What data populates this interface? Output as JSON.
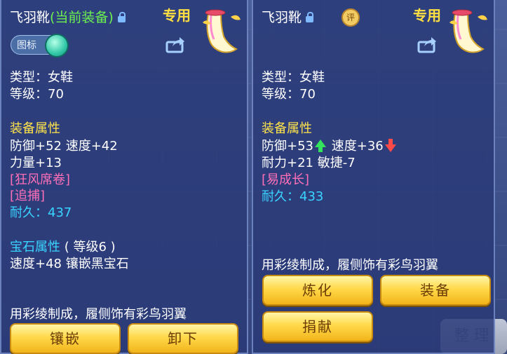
{
  "left": {
    "item_name": "飞羽靴",
    "current_tag": "(当前装备)",
    "exclusive": "专用",
    "icon_toggle": "图标",
    "type_line": "类型：女鞋",
    "level_line": "等级：70",
    "attr_header": "装备属性",
    "stat1": "防御+52 速度+42",
    "stat2": "力量+13",
    "skill1": "[狂风席卷]",
    "skill2": "[追捕]",
    "durability": "耐久：437",
    "gem_header": "宝石属性",
    "gem_level": "( 等级6 )",
    "gem_detail": "速度+48 镶嵌黑宝石",
    "description": "用彩绫制成，履侧饰有彩鸟羽翼",
    "buttons": {
      "inlay": "镶嵌",
      "unequip": "卸下"
    }
  },
  "right": {
    "item_name": "飞羽靴",
    "eval_badge": "评",
    "exclusive": "专用",
    "type_line": "类型：女鞋",
    "level_line": "等级：70",
    "attr_header": "装备属性",
    "stat1_a": "防御+53",
    "stat1_b": "速度+36",
    "stat2": "耐力+21 敏捷-7",
    "skill1": "[易成长]",
    "durability": "耐久：433",
    "description": "用彩绫制成，履侧饰有彩鸟羽翼",
    "buttons": {
      "refine": "炼化",
      "equip": "装备",
      "donate": "捐献"
    }
  },
  "background": {
    "sort_button": "整理"
  },
  "colors": {
    "panel": "#2a3a78",
    "name_white": "#ffffff",
    "current_green": "#6cf24e",
    "header_yellow": "#ffe34a",
    "skill_pink": "#ff6fb8",
    "durability_cyan": "#39d4ff",
    "button_gold": "#ffd94a"
  }
}
